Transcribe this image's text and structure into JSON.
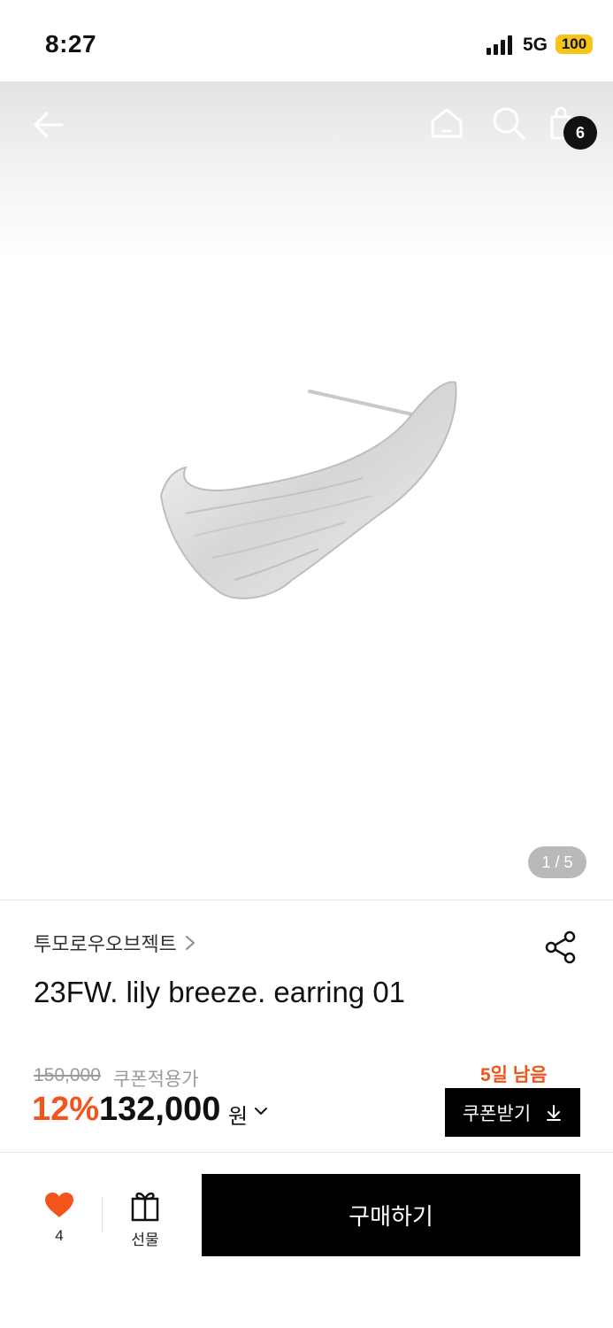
{
  "status_bar": {
    "time": "8:27",
    "network": "5G",
    "battery": "100"
  },
  "header": {
    "back_icon": "arrow-left-icon",
    "home_icon": "home-icon",
    "search_icon": "search-icon",
    "cart_icon": "shopping-bag-icon",
    "cart_count": "6"
  },
  "gallery": {
    "image": "silver-earring-product-photo",
    "counter": "1 / 5"
  },
  "product": {
    "brand": "투모로우오브젝트",
    "title": "23FW. lily breeze. earring 01",
    "original_price": "150,000",
    "coupon_price_label": "쿠폰적용가",
    "discount": "12%",
    "final_price": "132,000",
    "currency": "원",
    "days_left": "5일 남음",
    "coupon_button": "쿠폰받기"
  },
  "bottom_bar": {
    "like_count": "4",
    "gift_label": "선물",
    "buy_label": "구매하기"
  },
  "colors": {
    "accent": "#f2541b",
    "primary": "#000000",
    "battery": "#f5c518"
  }
}
